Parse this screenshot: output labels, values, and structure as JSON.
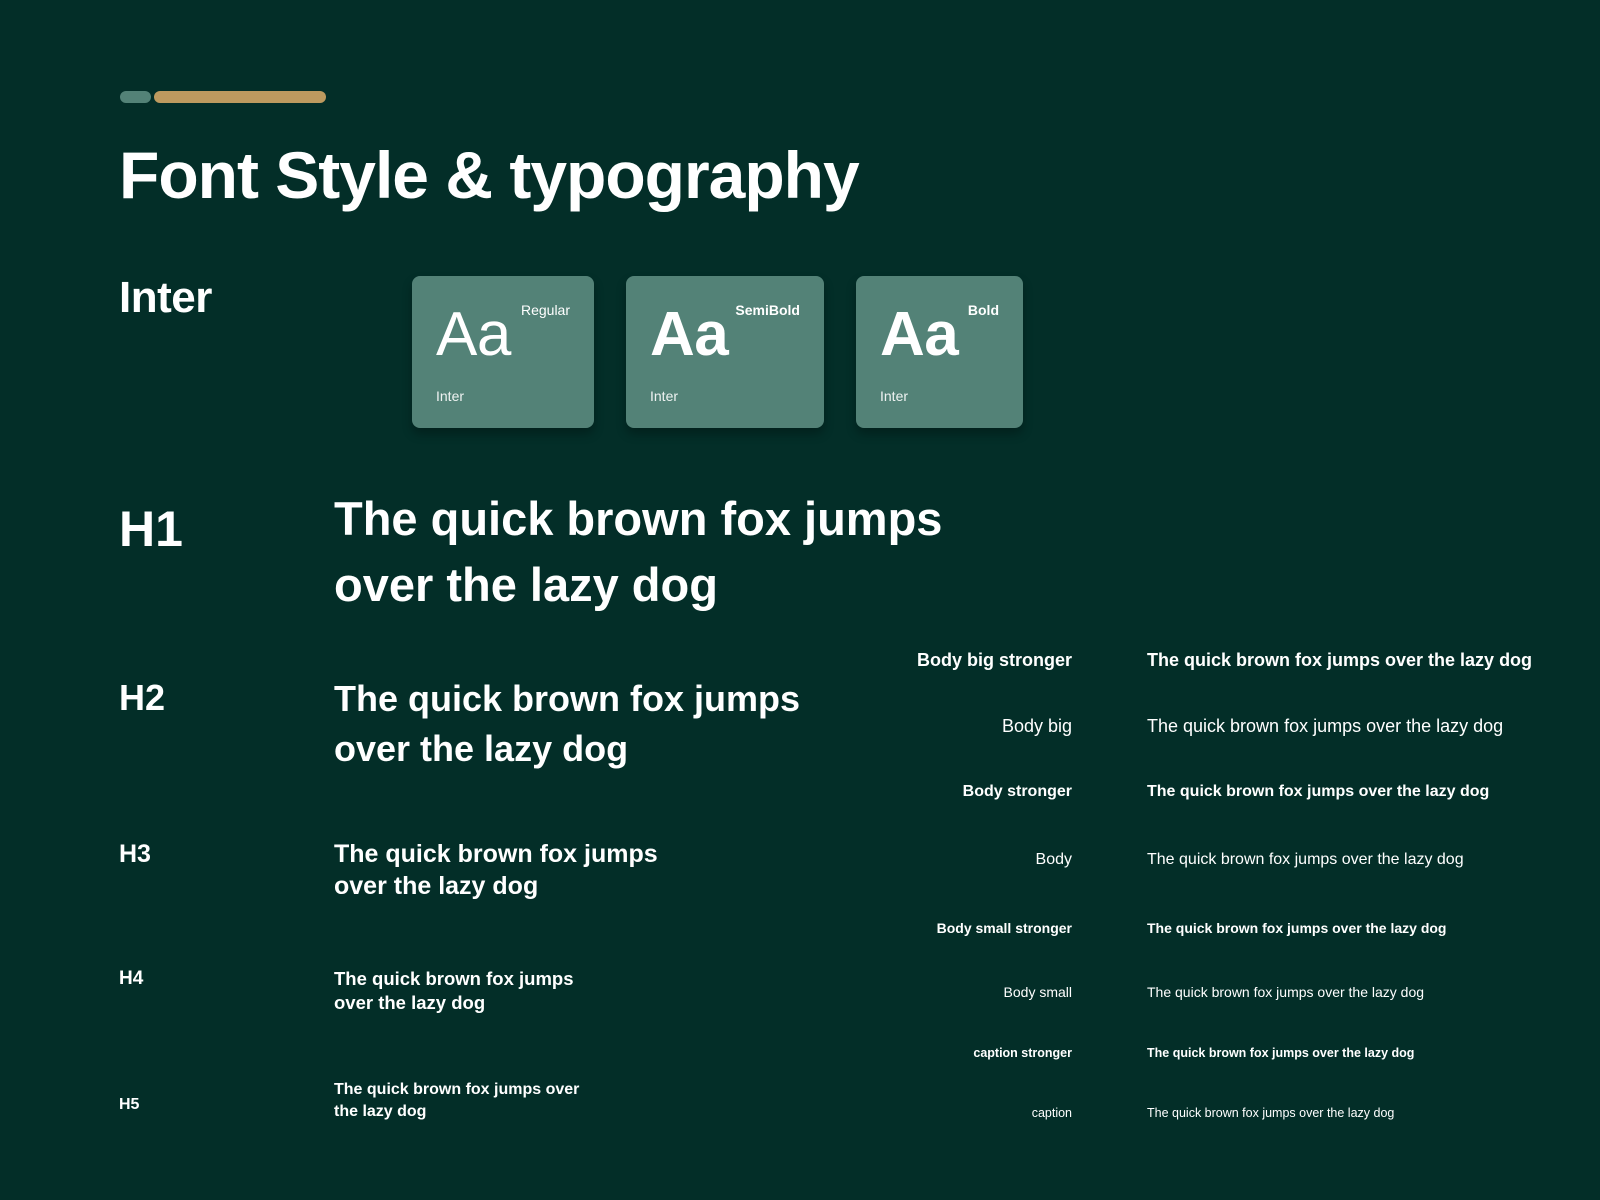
{
  "colors": {
    "background": "#032e28",
    "bar_short": "#538277",
    "bar_long": "#bd9a5f",
    "card": "#538277",
    "text": "#ffffff"
  },
  "title": "Font Style & typography",
  "font_family": {
    "name": "Inter",
    "cards": [
      {
        "sample": "Aa",
        "weight": "Regular",
        "family": "Inter"
      },
      {
        "sample": "Aa",
        "weight": "SemiBold",
        "family": "Inter"
      },
      {
        "sample": "Aa",
        "weight": "Bold",
        "family": "Inter"
      }
    ]
  },
  "headings": [
    {
      "level": "H1",
      "line1": "The quick brown fox jumps",
      "line2": "over the lazy dog"
    },
    {
      "level": "H2",
      "line1": "The quick brown fox jumps",
      "line2": "over the lazy dog"
    },
    {
      "level": "H3",
      "line1": "The quick brown fox jumps",
      "line2": "over the lazy dog"
    },
    {
      "level": "H4",
      "line1": "The quick brown fox jumps",
      "line2": "over the lazy dog"
    },
    {
      "level": "H5",
      "line1": "The quick brown fox jumps over",
      "line2": "the lazy dog"
    }
  ],
  "body_styles": [
    {
      "label": "Body big stronger",
      "sample": "The quick brown fox jumps over the lazy dog"
    },
    {
      "label": "Body big",
      "sample": "The quick brown fox jumps over the lazy dog"
    },
    {
      "label": "Body stronger",
      "sample": "The quick brown fox jumps over the lazy dog"
    },
    {
      "label": "Body",
      "sample": "The quick brown fox jumps over the lazy dog"
    },
    {
      "label": "Body small stronger",
      "sample": "The quick brown fox jumps over the lazy dog"
    },
    {
      "label": "Body small",
      "sample": "The quick brown fox jumps over the lazy dog"
    },
    {
      "label": "caption stronger",
      "sample": "The quick brown fox jumps over the lazy dog"
    },
    {
      "label": "caption",
      "sample": "The quick brown fox jumps over the lazy dog"
    }
  ]
}
